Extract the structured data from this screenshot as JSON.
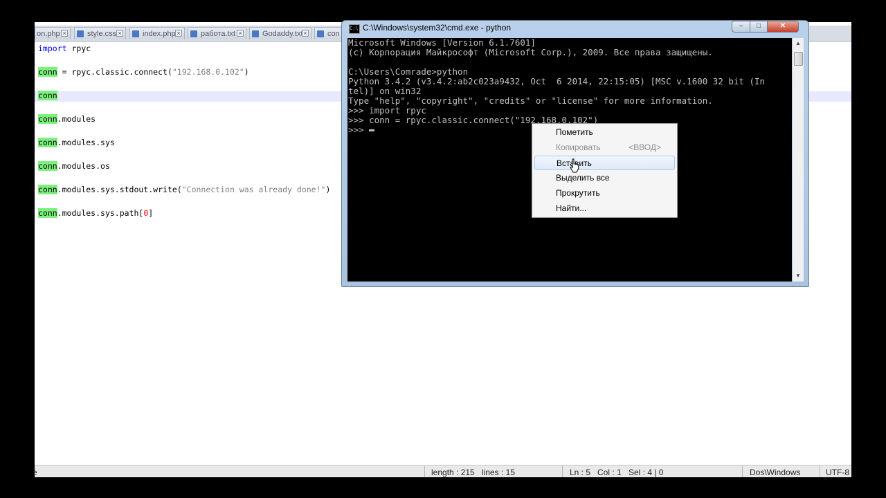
{
  "editor": {
    "tabs": [
      {
        "label": "on.php"
      },
      {
        "label": "style.css"
      },
      {
        "label": "index.php"
      },
      {
        "label": "работа.txt"
      },
      {
        "label": "Godaddy.txt"
      },
      {
        "label": "con"
      }
    ],
    "code_lines": [
      {
        "kw": "import",
        "rest": " rpyc"
      },
      {
        "hl": "conn",
        "rest": " = rpyc.classic.connect(",
        "str": "\"192.168.0.102\"",
        "tail": ")"
      },
      {
        "hl": "conn"
      },
      {
        "hl": "conn",
        "rest": ".modules"
      },
      {
        "hl": "conn",
        "rest": ".modules.sys"
      },
      {
        "hl": "conn",
        "rest": ".modules.os"
      },
      {
        "hl": "conn",
        "rest": ".modules.sys.stdout.write(",
        "str": "\"Connection was already done!\"",
        "tail": ")"
      },
      {
        "hl": "conn",
        "rest": ".modules.sys.path[",
        "num": "0",
        "tail": "]"
      }
    ],
    "status": {
      "left_fragment": "e",
      "length": "length : 215",
      "lines": "lines : 15",
      "ln": "Ln : 5",
      "col": "Col : 1",
      "sel": "Sel : 4 | 0",
      "eol": "Dos\\Windows",
      "encoding": "UTF-8"
    }
  },
  "cmd": {
    "title": "C:\\Windows\\system32\\cmd.exe - python",
    "icon_text": "C:\\",
    "buttons": {
      "minimize": "–",
      "maximize": "□",
      "close": "✕"
    },
    "console_lines": [
      "Microsoft Windows [Version 6.1.7601]",
      "(c) Корпорация Майкрософт (Microsoft Corp.), 2009. Все права защищены.",
      "",
      "C:\\Users\\Comrade>python",
      "Python 3.4.2 (v3.4.2:ab2c023a9432, Oct  6 2014, 22:15:05) [MSC v.1600 32 bit (In",
      "tel)] on win32",
      "Type \"help\", \"copyright\", \"credits\" or \"license\" for more information.",
      ">>> import rpyc",
      ">>> conn = rpyc.classic.connect(\"192.168.0.102\")"
    ],
    "prompt": ">>> ",
    "scroll_arrows": {
      "up": "▲",
      "down": "▼"
    }
  },
  "context_menu": {
    "items": [
      {
        "label": "Пометить",
        "state": "normal",
        "accel": ""
      },
      {
        "label": "Копировать",
        "state": "disabled",
        "accel": "<ВВОД>"
      },
      {
        "label": "Вставить",
        "state": "active",
        "accel": ""
      },
      {
        "label": "Выделить все",
        "state": "normal",
        "accel": ""
      },
      {
        "label": "Прокрутить",
        "state": "normal",
        "accel": ""
      },
      {
        "label": "Найти...",
        "state": "normal",
        "accel": ""
      }
    ]
  }
}
